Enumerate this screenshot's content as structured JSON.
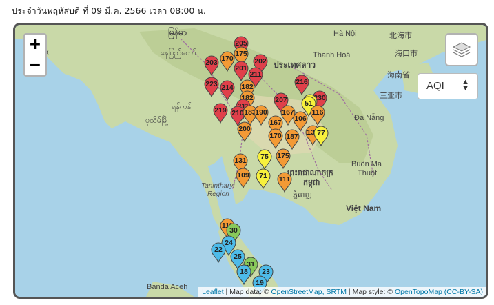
{
  "caption": "ประจำวันพฤหัสบดี ที่ 09 มี.ค. 2566 เวลา 08:00 น.",
  "zoom": {
    "in_label": "+",
    "out_label": "−"
  },
  "pollutant_select": {
    "selected": "AQI"
  },
  "attribution": {
    "leaflet": "Leaflet",
    "sep1": " | Map data: © ",
    "osm": "OpenStreetMap, SRTM",
    "sep2": " | Map style: © ",
    "otm": "OpenTopoMap (CC-BY-SA)"
  },
  "places": [
    {
      "name": "မြန်မာ"
    },
    {
      "name": "Hà Nội"
    },
    {
      "name": "北海市"
    },
    {
      "name": "Thanh Hoá"
    },
    {
      "name": "海口市"
    },
    {
      "name": "海南省"
    },
    {
      "name": "ประเทศลาว"
    },
    {
      "name": "三亚市"
    },
    {
      "name": "Đà Nẵng"
    },
    {
      "name": "နေပြည်တော်"
    },
    {
      "name": "ရန်ကုန်"
    },
    {
      "name": "ပုသိမ်မြို့"
    },
    {
      "name": "Tanintharyi"
    },
    {
      "name": "Region"
    },
    {
      "name": "ព្រះរាជាណាចក្រ"
    },
    {
      "name": "កម្ពុជា"
    },
    {
      "name": "ភ្នំពេញ"
    },
    {
      "name": "Buôn Ma"
    },
    {
      "name": "Thuột"
    },
    {
      "name": "Việt Nam"
    },
    {
      "name": "Banda Aceh"
    },
    {
      "name": "k"
    }
  ],
  "stations": [
    {
      "aqi": "205"
    },
    {
      "aqi": "175"
    },
    {
      "aqi": "170"
    },
    {
      "aqi": "202"
    },
    {
      "aqi": "203"
    },
    {
      "aqi": "201"
    },
    {
      "aqi": "211"
    },
    {
      "aqi": "216"
    },
    {
      "aqi": "223"
    },
    {
      "aqi": "214"
    },
    {
      "aqi": "182"
    },
    {
      "aqi": "182"
    },
    {
      "aqi": "211"
    },
    {
      "aqi": "230"
    },
    {
      "aqi": "207"
    },
    {
      "aqi": "72"
    },
    {
      "aqi": "51"
    },
    {
      "aqi": "219"
    },
    {
      "aqi": "210"
    },
    {
      "aqi": "183"
    },
    {
      "aqi": "190"
    },
    {
      "aqi": "167"
    },
    {
      "aqi": "116"
    },
    {
      "aqi": "106"
    },
    {
      "aqi": "167"
    },
    {
      "aqi": "200"
    },
    {
      "aqi": "170"
    },
    {
      "aqi": "187"
    },
    {
      "aqi": "137"
    },
    {
      "aqi": "77"
    },
    {
      "aqi": "175"
    },
    {
      "aqi": "131"
    },
    {
      "aqi": "75"
    },
    {
      "aqi": "109"
    },
    {
      "aqi": "71"
    },
    {
      "aqi": "111"
    },
    {
      "aqi": "111"
    },
    {
      "aqi": "30"
    },
    {
      "aqi": "24"
    },
    {
      "aqi": "22"
    },
    {
      "aqi": "25"
    },
    {
      "aqi": "31"
    },
    {
      "aqi": "18"
    },
    {
      "aqi": "23"
    },
    {
      "aqi": "19"
    }
  ],
  "colors": {
    "very_unhealthy": "#e0404a",
    "unhealthy": "#f39a35",
    "moderate": "#f7f03c",
    "good": "#88c95a",
    "very_good": "#4dbbe9"
  }
}
